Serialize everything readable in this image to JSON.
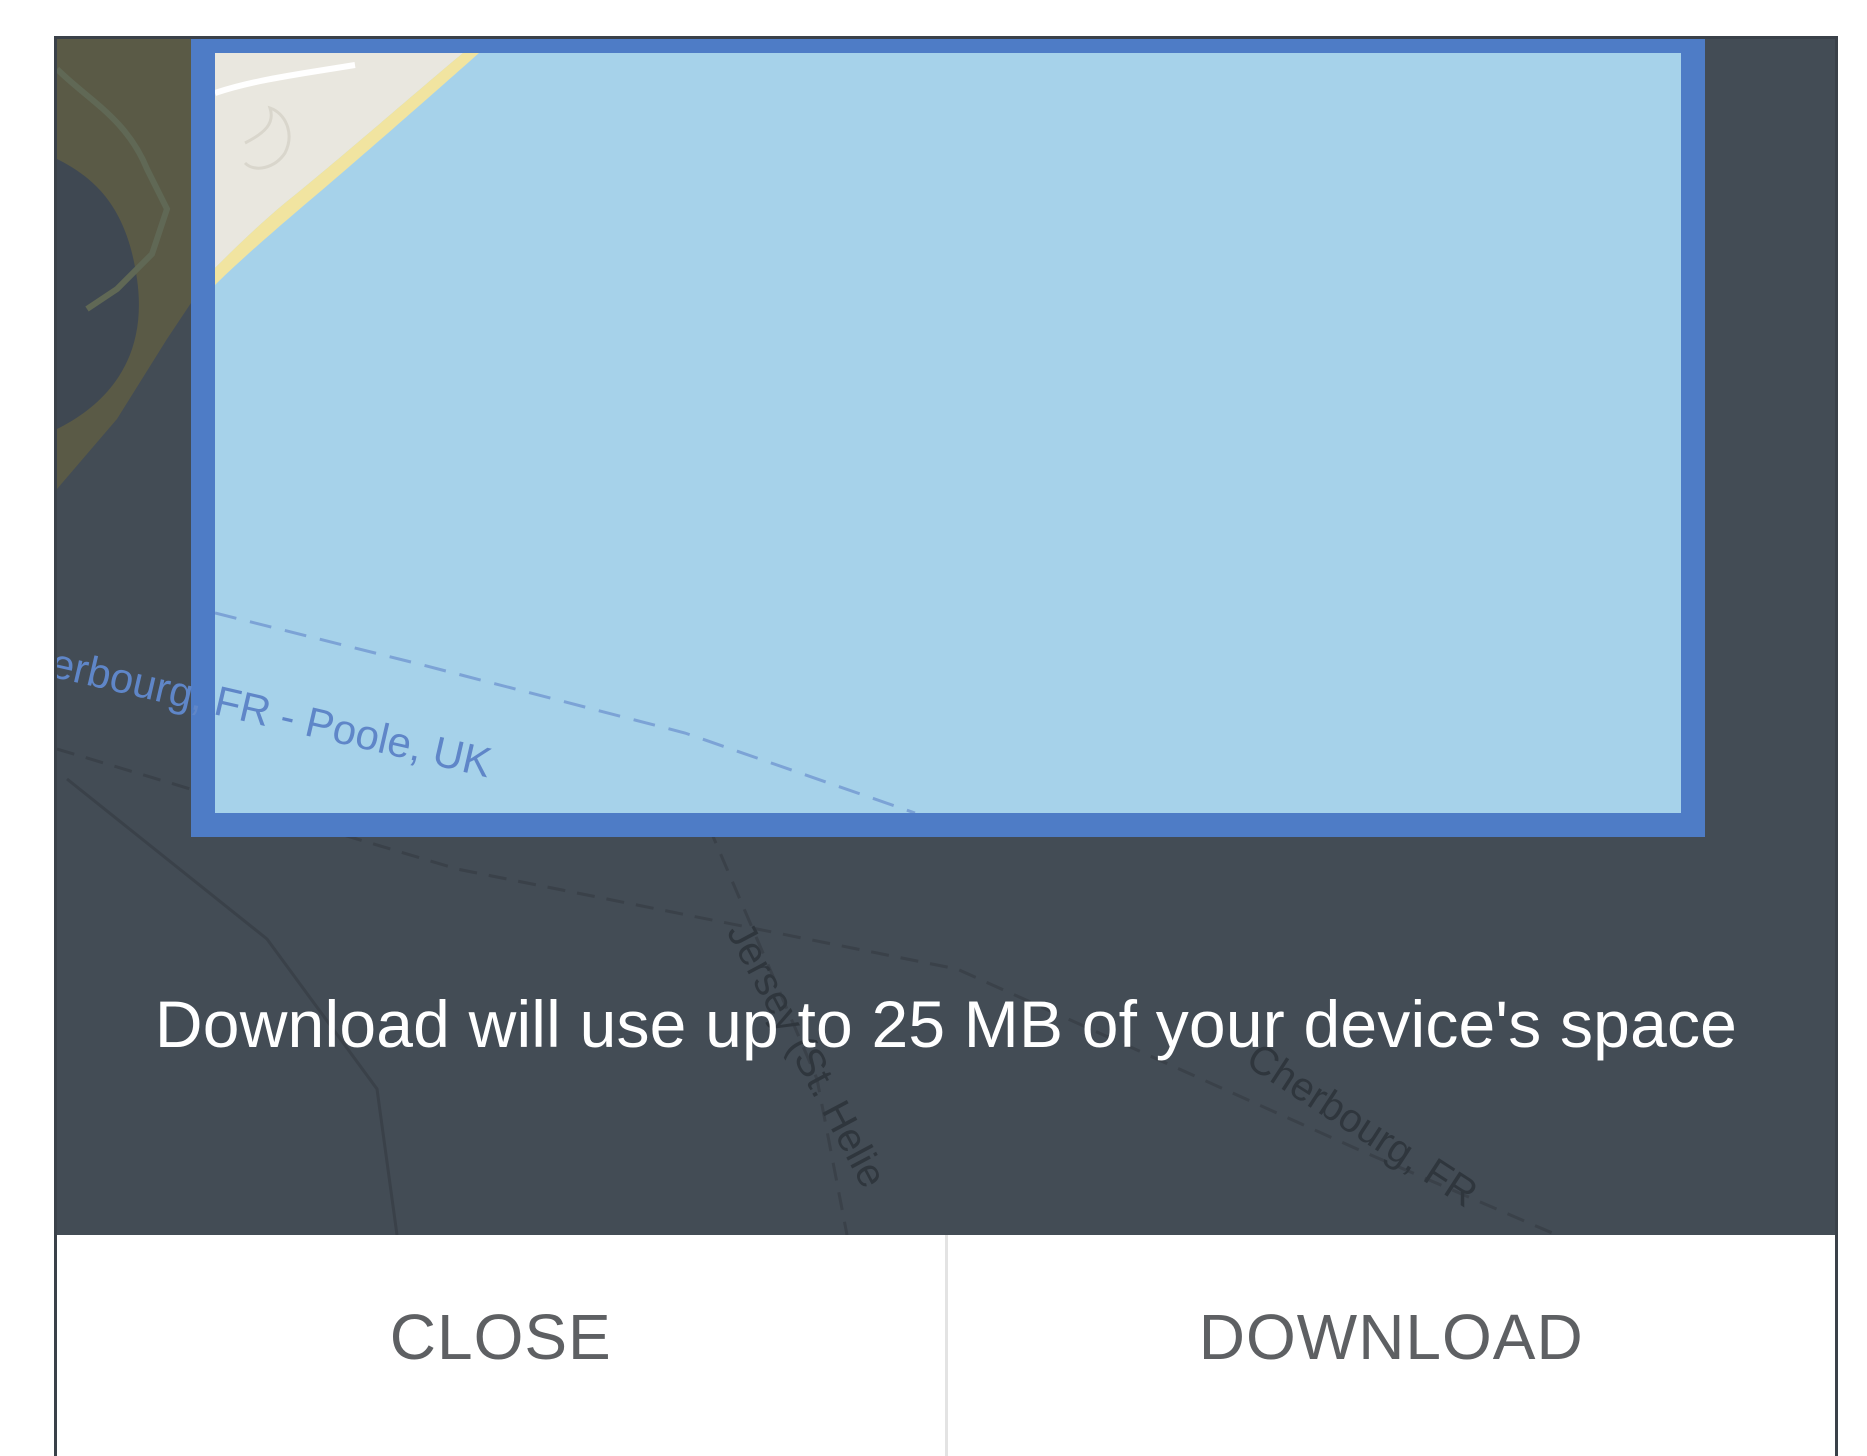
{
  "dialog": {
    "message": "Download will use up to 25 MB of your device's space",
    "close_label": "CLOSE",
    "download_label": "DOWNLOAD"
  },
  "map": {
    "ferry_route_label_left": "erbourg, FR - Poole, UK",
    "ferry_route_label_right": "Cherbourg, FR",
    "ferry_route_label_middle": "Jersey (St. Helie",
    "colors": {
      "overlay": "#434c55",
      "selection_fill": "#a8d5ee",
      "selection_border": "#4e7cc6",
      "land_green": "#5d6b4e",
      "land_beige": "#e9e7df",
      "beach_yellow": "#f1e4a0",
      "route_label": "#5f86c8"
    }
  }
}
